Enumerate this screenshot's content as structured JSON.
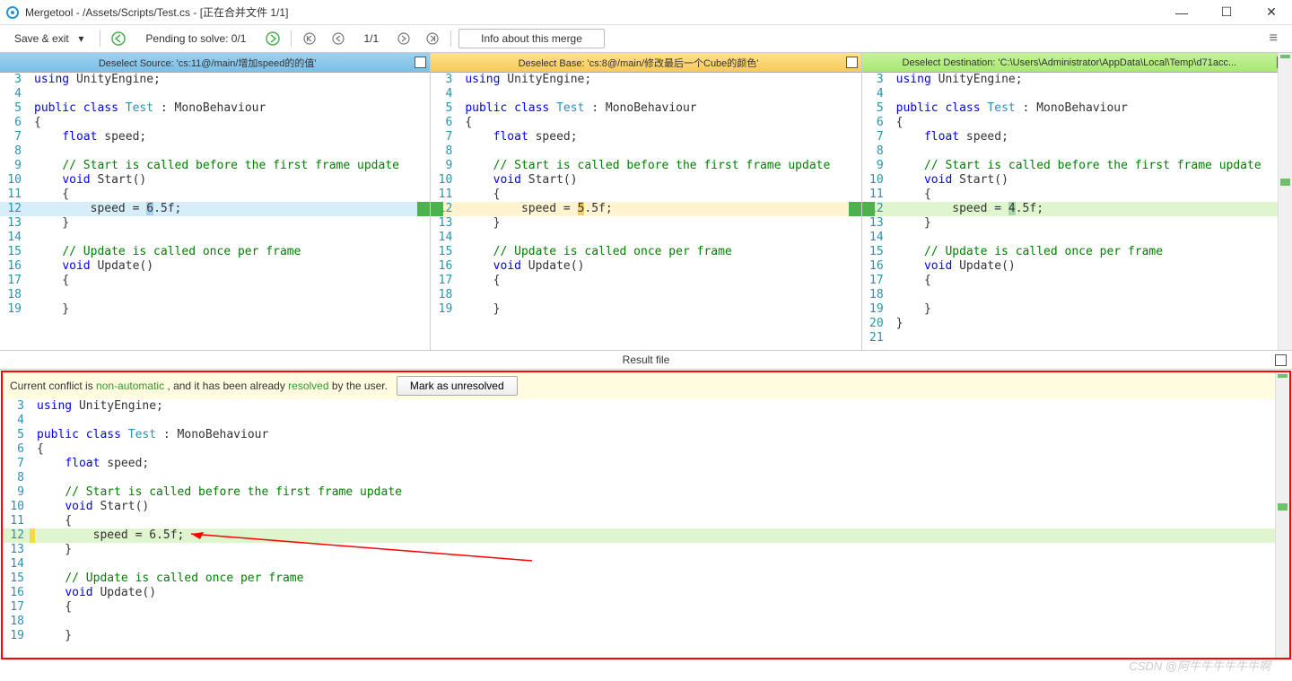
{
  "title": "Mergetool - /Assets/Scripts/Test.cs - [正在合并文件 1/1]",
  "toolbar": {
    "save_exit": "Save & exit",
    "pending": "Pending to solve: 0/1",
    "counter": "1/1",
    "info": "Info about this merge"
  },
  "panes": {
    "src": {
      "header": "Deselect Source: 'cs:11@/main/增加speed的的值'"
    },
    "base": {
      "header": "Deselect Base: 'cs:8@/main/修改最后一个Cube的颜色'"
    },
    "dst": {
      "header": "Deselect Destination: 'C:\\Users\\Administrator\\AppData\\Local\\Temp\\d71acc..."
    }
  },
  "code": {
    "using": "using",
    "UnityEngine": "UnityEngine;",
    "public": "public",
    "class": "class",
    "Test": "Test",
    "colon_mono": " : MonoBehaviour",
    "lbrace": "{",
    "rbrace": "}",
    "float_speed": "float",
    "speed_decl": " speed;",
    "cmt_start": "// Start is called before the first frame update",
    "void": "void",
    "Start": " Start()",
    "speed_eq": "speed = ",
    "src_val": "6",
    "base_val": "5",
    "dst_val": "4",
    "suffix": ".5f;",
    "cmt_update": "// Update is called once per frame",
    "Update": " Update()",
    "empty": ""
  },
  "result": {
    "header": "Result file",
    "conflict_pre": "Current conflict is ",
    "conflict_na": "non-automatic",
    "conflict_mid": " , and it has been already ",
    "conflict_res": "resolved",
    "conflict_post": " by the user.",
    "mark_btn": "Mark as unresolved",
    "val": "6",
    "suffix": ".5f;"
  },
  "watermark": "CSDN @阿牛牛牛牛牛牛啊"
}
